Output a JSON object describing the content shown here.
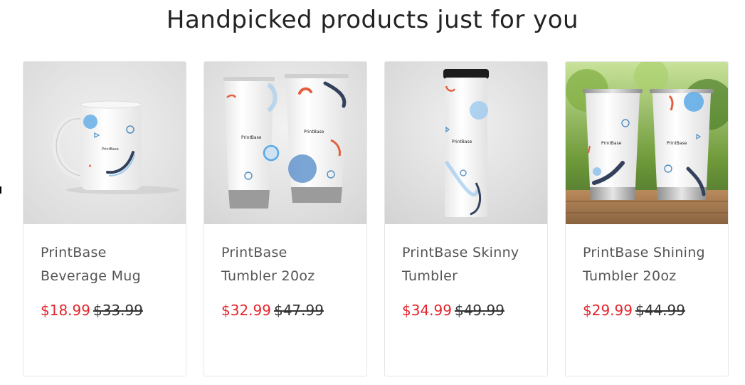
{
  "section": {
    "title": "Handpicked products just for you"
  },
  "products": [
    {
      "title_line1": "PrintBase",
      "title_line2": "Beverage Mug",
      "sale_price": "$18.99",
      "compare_price": "$33.99",
      "image_label": "PrintBase"
    },
    {
      "title_line1": "PrintBase",
      "title_line2": "Tumbler 20oz",
      "sale_price": "$32.99",
      "compare_price": "$47.99",
      "image_label": "PrintBase"
    },
    {
      "title_line1": "PrintBase Skinny",
      "title_line2": "Tumbler",
      "sale_price": "$34.99",
      "compare_price": "$49.99",
      "image_label": "PrintBase"
    },
    {
      "title_line1": "PrintBase Shining",
      "title_line2": "Tumbler 20oz",
      "sale_price": "$29.99",
      "compare_price": "$44.99",
      "image_label": "PrintBase"
    }
  ],
  "colors": {
    "sale_price": "#e2252b",
    "accent_blue": "#5aa9e6",
    "accent_navy": "#33415c",
    "accent_orange": "#e2603f"
  }
}
